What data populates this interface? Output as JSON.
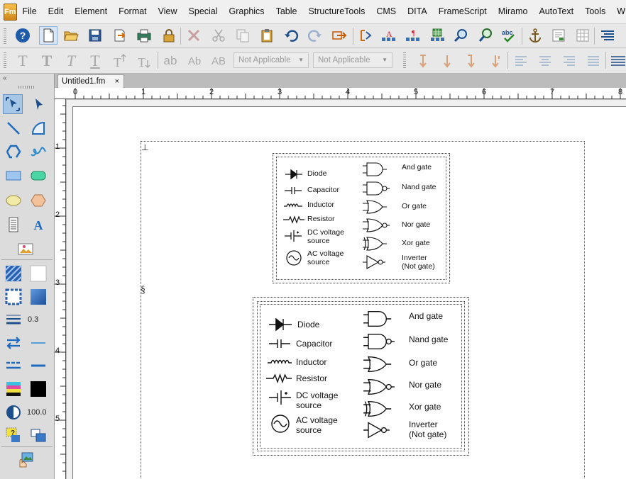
{
  "app": {
    "logo": "Fm"
  },
  "menu": [
    "File",
    "Edit",
    "Element",
    "Format",
    "View",
    "Special",
    "Graphics",
    "Table",
    "StructureTools",
    "CMS",
    "DITA",
    "FrameScript",
    "Miramo",
    "AutoText",
    "Tools",
    "W"
  ],
  "toolbar2": {
    "char_styles": [
      "T",
      "T",
      "T",
      "T"
    ],
    "case_buttons": [
      "ab",
      "Ab",
      "AB"
    ],
    "dropdown1": "Not Applicable",
    "dropdown2": "Not Applicable"
  },
  "document": {
    "tab_title": "Untitled1.fm",
    "tab_close": "×"
  },
  "ruler": {
    "horizontal": [
      "0",
      "1",
      "2",
      "3",
      "4",
      "5",
      "6",
      "7",
      "8"
    ],
    "vertical": [
      "1",
      "2",
      "3",
      "4",
      "5"
    ]
  },
  "tools_panel": {
    "line_width": "0.3",
    "tint": "100.0",
    "collapse": "«"
  },
  "page": {
    "anchor_symbol_1": "⊥",
    "anchor_symbol_2": "§"
  },
  "legend_small": {
    "components": [
      "Diode",
      "Capacitor",
      "Inductor",
      "Resistor",
      "DC voltage",
      "source",
      "AC voltage",
      "source"
    ],
    "gates": [
      "And gate",
      "Nand gate",
      "Or gate",
      "Nor gate",
      "Xor gate",
      "Inverter",
      "(Not gate)"
    ]
  },
  "legend_large": {
    "components": [
      "Diode",
      "Capacitor",
      "Inductor",
      "Resistor",
      "DC voltage",
      "source",
      "AC voltage",
      "source"
    ],
    "gates": [
      "And gate",
      "Nand gate",
      "Or gate",
      "Nor gate",
      "Xor gate",
      "Inverter",
      "(Not gate)"
    ]
  },
  "colors": {
    "selected_tool": "#a7c7e6",
    "panel": "#dcdcdc",
    "toolbar": "#e8e8e8"
  }
}
